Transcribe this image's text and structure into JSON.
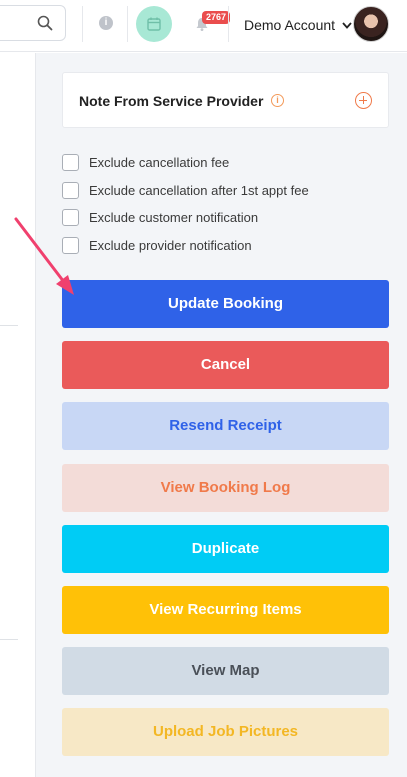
{
  "header": {
    "account_name": "Demo Account",
    "notification_count": "2767"
  },
  "note": {
    "title": "Note From Service Provider"
  },
  "checkboxes": [
    {
      "label": "Exclude cancellation fee",
      "checked": false
    },
    {
      "label": "Exclude cancellation after 1st appt fee",
      "checked": false
    },
    {
      "label": "Exclude customer notification",
      "checked": false
    },
    {
      "label": "Exclude provider notification",
      "checked": false
    }
  ],
  "buttons": {
    "update": "Update Booking",
    "cancel": "Cancel",
    "resend_receipt": "Resend Receipt",
    "view_log": "View Booking Log",
    "duplicate": "Duplicate",
    "view_recurring": "View Recurring Items",
    "view_map": "View Map",
    "upload_pictures": "Upload Job Pictures"
  },
  "colors": {
    "update_bg": "#2f62e8",
    "cancel_bg": "#ea5a5a",
    "resend_bg": "#c8d7f5",
    "resend_text": "#2f62e8",
    "log_bg": "#f3dcd8",
    "log_text": "#f07a4a",
    "duplicate_bg": "#00ccf5",
    "recurring_bg": "#ffc107",
    "map_bg": "#d1dbe5",
    "map_text": "#4a5058",
    "upload_bg": "#f7e8c6",
    "upload_text": "#f3b724",
    "annotation_arrow": "#f0406e"
  }
}
